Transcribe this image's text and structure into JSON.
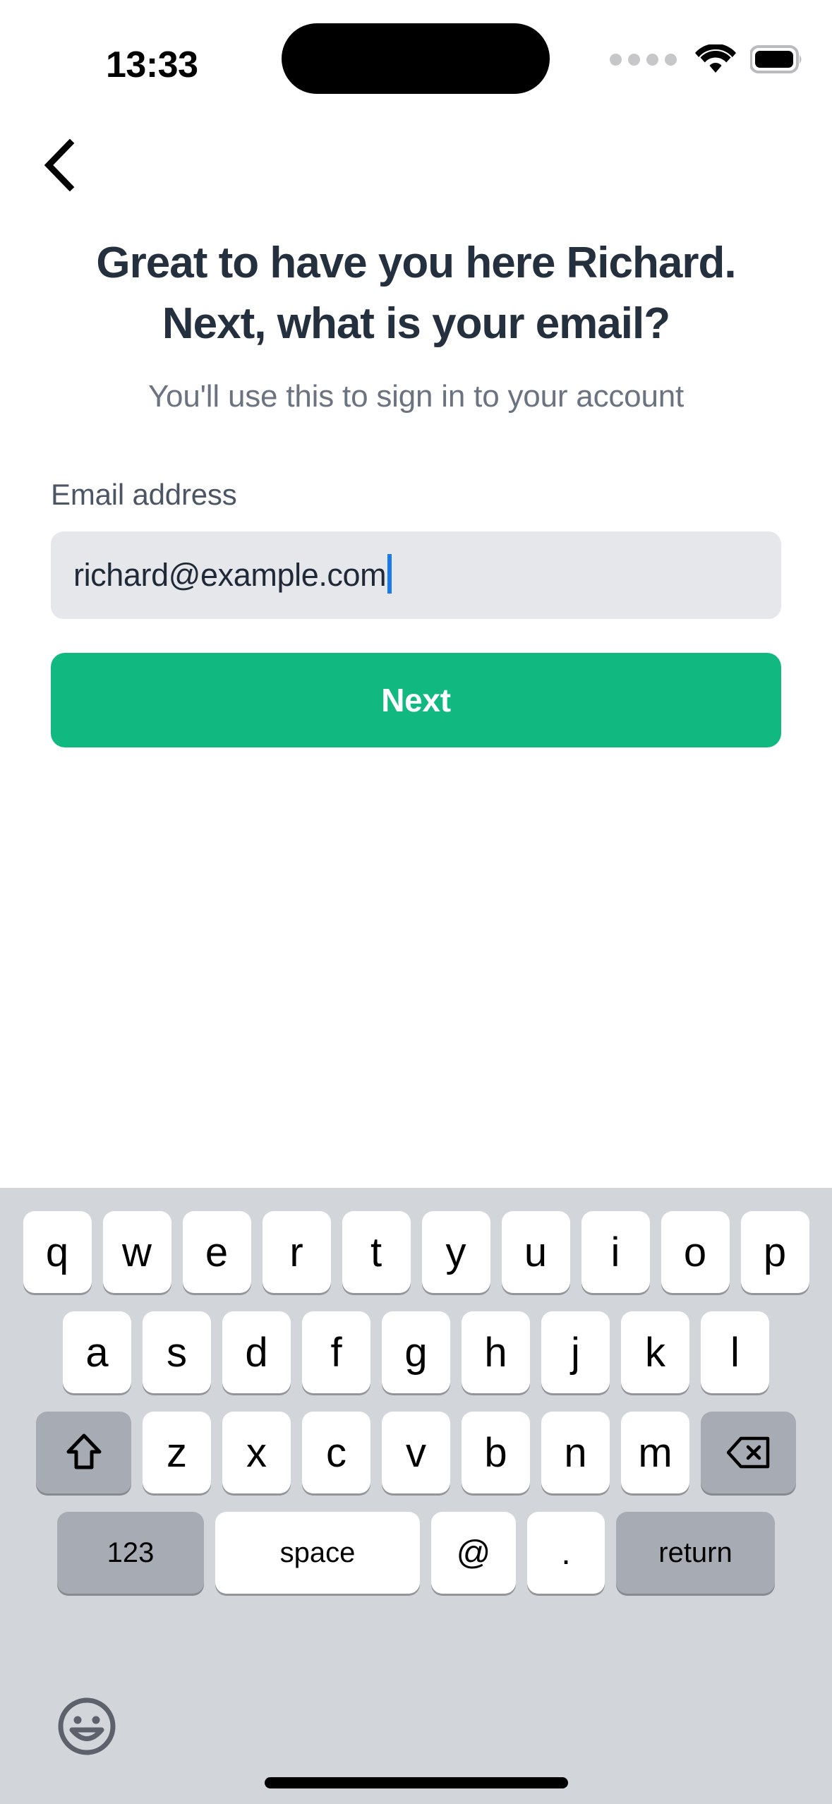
{
  "status_bar": {
    "time": "13:33",
    "signal_icon": "signal-dots-icon",
    "wifi_icon": "wifi-icon",
    "battery_icon": "battery-icon"
  },
  "nav": {
    "back_icon": "chevron-left-icon"
  },
  "content": {
    "title": "Great to have you here Richard. Next, what is your email?",
    "subtitle": "You'll use this to sign in to your account"
  },
  "form": {
    "email_label": "Email address",
    "email_value": "richard@example.com",
    "email_placeholder": "Email address",
    "next_label": "Next"
  },
  "colors": {
    "accent_green": "#11b981",
    "title_navy": "#25303f",
    "subtitle_gray": "#6b7280",
    "field_bg": "#e5e7eb",
    "cursor_blue": "#1a7bf0",
    "keyboard_bg": "#d2d5da",
    "key_mod_bg": "#a7abb3"
  },
  "keyboard": {
    "row1": [
      "q",
      "w",
      "e",
      "r",
      "t",
      "y",
      "u",
      "i",
      "o",
      "p"
    ],
    "row2": [
      "a",
      "s",
      "d",
      "f",
      "g",
      "h",
      "j",
      "k",
      "l"
    ],
    "row3_letters": [
      "z",
      "x",
      "c",
      "v",
      "b",
      "n",
      "m"
    ],
    "shift_icon": "shift-arrow-icon",
    "backspace_icon": "backspace-delete-icon",
    "row4": {
      "numbers_label": "123",
      "space_label": "space",
      "at_label": "@",
      "dot_label": ".",
      "return_label": "return"
    },
    "emoji_icon": "emoji-smiley-icon"
  }
}
